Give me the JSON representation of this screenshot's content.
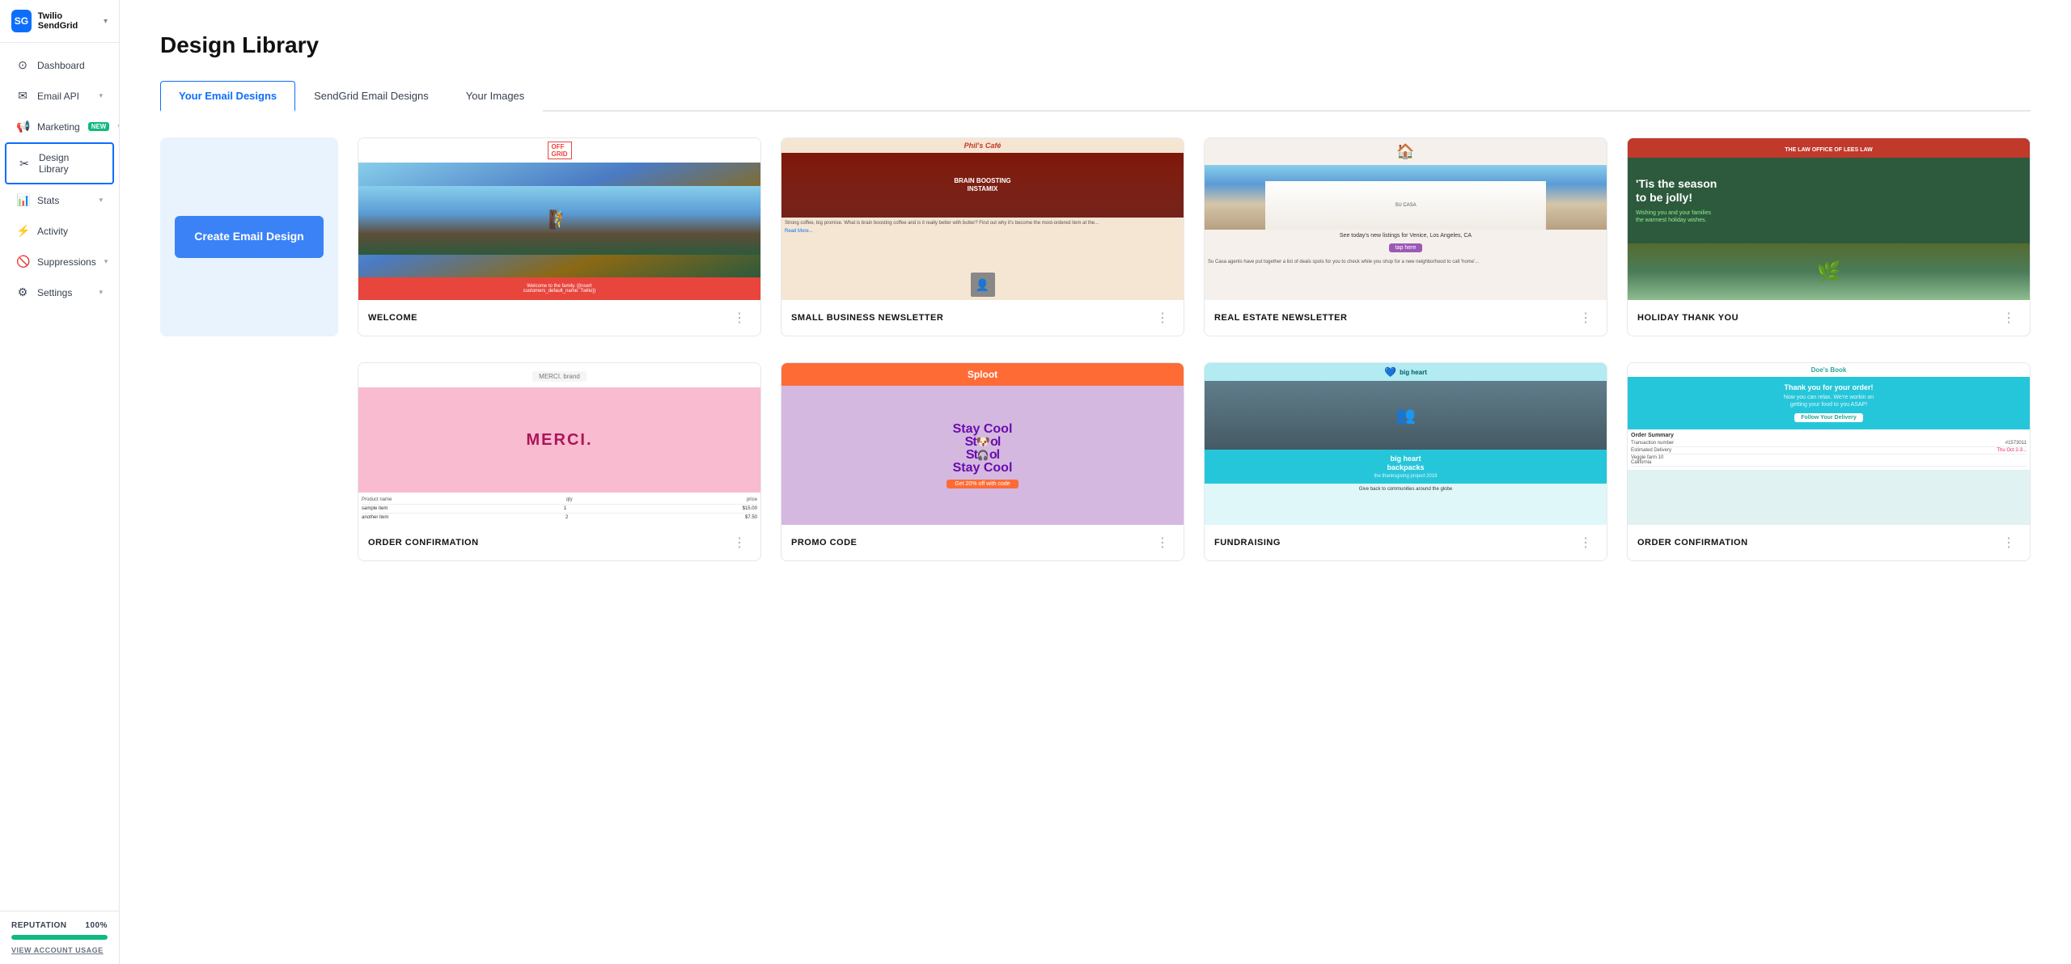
{
  "app": {
    "brand": "Twilio SendGrid",
    "brand_logo": "SG"
  },
  "sidebar": {
    "items": [
      {
        "id": "dashboard",
        "label": "Dashboard",
        "icon": "⊙",
        "has_chevron": false,
        "badge": null,
        "active": false
      },
      {
        "id": "email-api",
        "label": "Email API",
        "icon": "✉",
        "has_chevron": true,
        "badge": null,
        "active": false
      },
      {
        "id": "marketing",
        "label": "Marketing",
        "icon": "📢",
        "has_chevron": true,
        "badge": "NEW",
        "active": false
      },
      {
        "id": "design-library",
        "label": "Design Library",
        "icon": "✂",
        "has_chevron": false,
        "badge": null,
        "active": true
      },
      {
        "id": "stats",
        "label": "Stats",
        "icon": "📊",
        "has_chevron": true,
        "badge": null,
        "active": false
      },
      {
        "id": "activity",
        "label": "Activity",
        "icon": "⚡",
        "has_chevron": false,
        "badge": null,
        "active": false
      },
      {
        "id": "suppressions",
        "label": "Suppressions",
        "icon": "🚫",
        "has_chevron": true,
        "badge": null,
        "active": false
      },
      {
        "id": "settings",
        "label": "Settings",
        "icon": "⚙",
        "has_chevron": true,
        "badge": null,
        "active": false
      }
    ],
    "reputation": {
      "label": "REPUTATION",
      "value": "100%",
      "percent": 100
    },
    "view_account_usage": "VIEW ACCOUNT USAGE"
  },
  "page": {
    "title": "Design Library"
  },
  "tabs": [
    {
      "id": "your-email-designs",
      "label": "Your Email Designs",
      "active": true
    },
    {
      "id": "sendgrid-email-designs",
      "label": "SendGrid Email Designs",
      "active": false
    },
    {
      "id": "your-images",
      "label": "Your Images",
      "active": false
    }
  ],
  "create_button": "Create Email\nDesign",
  "designs_row1": [
    {
      "id": "welcome",
      "name": "WELCOME",
      "thumbnail_type": "welcome"
    },
    {
      "id": "small-business-newsletter",
      "name": "SMALL BUSINESS NEWSLETTER",
      "thumbnail_type": "newsletter"
    },
    {
      "id": "real-estate-newsletter",
      "name": "REAL ESTATE NEWSLETTER",
      "thumbnail_type": "realestate"
    },
    {
      "id": "holiday-thank-you",
      "name": "HOLIDAY THANK YOU",
      "thumbnail_type": "holiday"
    }
  ],
  "designs_row2": [
    {
      "id": "order-confirmation-1",
      "name": "ORDER CONFIRMATION",
      "thumbnail_type": "order1"
    },
    {
      "id": "promo-code",
      "name": "PROMO CODE",
      "thumbnail_type": "promo"
    },
    {
      "id": "fundraising",
      "name": "FUNDRAISING",
      "thumbnail_type": "fundraising"
    },
    {
      "id": "order-confirmation-2",
      "name": "ORDER CONFIRMATION",
      "thumbnail_type": "order2"
    }
  ]
}
